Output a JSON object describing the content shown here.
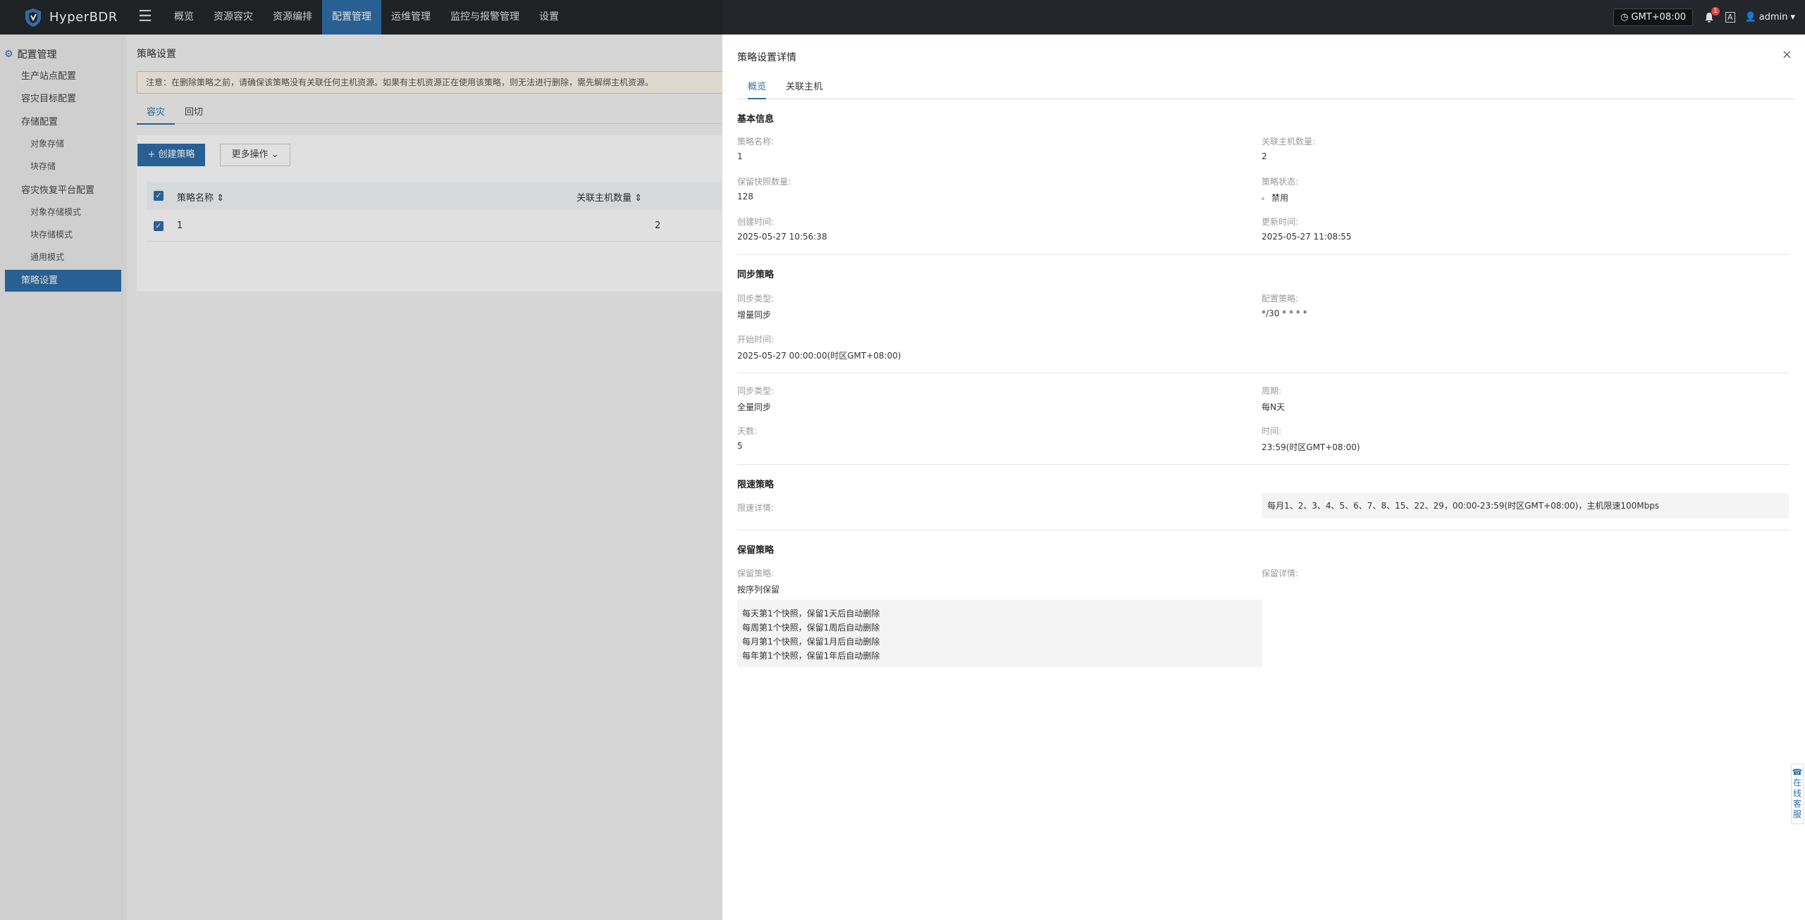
{
  "topbar": {
    "app_name": "HyperBDR",
    "nav": [
      "概览",
      "资源容灾",
      "资源编排",
      "配置管理",
      "运维管理",
      "监控与报警管理",
      "设置"
    ],
    "active_nav": 3,
    "timezone": "GMT+08:00",
    "notifications": "1",
    "lang_icon": "A",
    "user": "admin"
  },
  "sidebar": {
    "title": "配置管理",
    "items": [
      "生产站点配置",
      "容灾目标配置",
      "存储配置",
      "对象存储",
      "块存储",
      "容灾恢复平台配置",
      "对象存储模式",
      "块存储模式",
      "通用模式",
      "策略设置"
    ]
  },
  "main": {
    "crumb": "策略设置",
    "notice": "注意：在删除策略之前，请确保该策略没有关联任何主机资源。如果有主机资源正在使用该策略，则无法进行删除，需先解绑主机资源。",
    "tabs": [
      "容灾",
      "回切"
    ],
    "create_button": "+ 创建策略",
    "more_button": "更多操作",
    "columns": [
      "策略名称",
      "关联主机数量"
    ],
    "row": {
      "name": "1",
      "hosts": "2"
    }
  },
  "drawer": {
    "title": "策略设置详情",
    "close": "×",
    "tabs": [
      "概览",
      "关联主机"
    ],
    "basic": {
      "heading": "基本信息",
      "name_label": "策略名称:",
      "name_value": "1",
      "hosts_label": "关联主机数量:",
      "hosts_value": "2",
      "snap_label": "保留快照数量:",
      "snap_value": "128",
      "status_label": "策略状态:",
      "status_value": "禁用",
      "created_label": "创建时间:",
      "created_value": "2025-05-27 10:56:38",
      "updated_label": "更新时间:",
      "updated_value": "2025-05-27 11:08:55"
    },
    "sync": {
      "heading": "同步策略",
      "type1_label": "同步类型:",
      "type1_value": "增量同步",
      "cron_label": "配置策略:",
      "cron_value": "*/30 * * * *",
      "start_label": "开始时间:",
      "start_value": "2025-05-27 00:00:00(时区GMT+08:00)",
      "type2_label": "同步类型:",
      "type2_value": "全量同步",
      "period_label": "周期:",
      "period_value": "每N天",
      "days_label": "天数:",
      "days_value": "5",
      "time_label": "时间:",
      "time_value": "23:59(时区GMT+08:00)"
    },
    "limit": {
      "heading": "限速策略",
      "detail_label": "限速详情:",
      "detail_value": "每月1、2、3、4、5、6、7、8、15、22、29，00:00-23:59(时区GMT+08:00)，主机限速100Mbps"
    },
    "retain": {
      "heading": "保留策略",
      "policy_label": "保留策略:",
      "policy_value": "按序列保留",
      "detail_label": "保留详情:",
      "lines": [
        "每天第1个快照，保留1天后自动删除",
        "每周第1个快照，保留1周后自动删除",
        "每月第1个快照，保留1月后自动删除",
        "每年第1个快照，保留1年后自动删除"
      ]
    }
  },
  "support": "在线客服"
}
